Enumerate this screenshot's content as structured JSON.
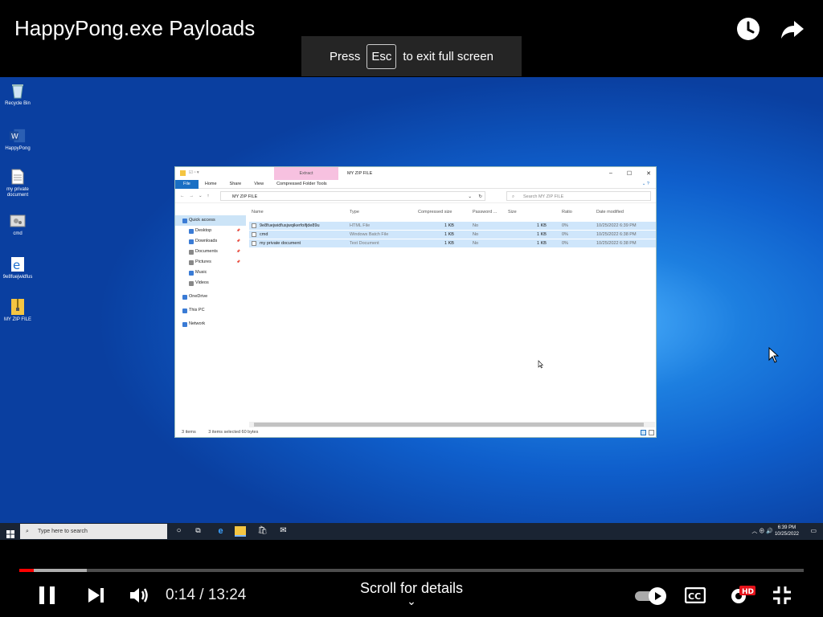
{
  "player": {
    "title": "HappyPong.exe Payloads",
    "esc_press": "Press",
    "esc_key": "Esc",
    "esc_suffix": "to exit full screen",
    "time": "0:14 / 13:24",
    "scroll_details": "Scroll for details",
    "progress_played": 0.018,
    "progress_buffered": 0.086,
    "hd_badge": "HD",
    "cc_label": "CC",
    "accent": "#ff0000"
  },
  "desktop": {
    "icons": [
      {
        "label": "Recycle Bin",
        "icon": "recycle-bin-icon"
      },
      {
        "label": "HappyPong",
        "icon": "word-doc-icon"
      },
      {
        "label": "my private document",
        "icon": "text-file-icon"
      },
      {
        "label": "cmd",
        "icon": "batch-file-icon"
      },
      {
        "label": "9e8fuejwidfus",
        "icon": "edge-html-icon"
      },
      {
        "label": "MY ZIP FILE",
        "icon": "zip-folder-icon"
      }
    ]
  },
  "explorer": {
    "extract_tab": "Extract",
    "title": "MY ZIP FILE",
    "ribbon": [
      "File",
      "Home",
      "Share",
      "View",
      "Compressed Folder Tools"
    ],
    "address": "MY ZIP FILE",
    "search_placeholder": "Search MY ZIP FILE",
    "nav": [
      {
        "label": "Quick access",
        "selected": true,
        "pinned": false
      },
      {
        "label": "Desktop",
        "selected": false,
        "pinned": true
      },
      {
        "label": "Downloads",
        "selected": false,
        "pinned": true
      },
      {
        "label": "Documents",
        "selected": false,
        "pinned": true
      },
      {
        "label": "Pictures",
        "selected": false,
        "pinned": true
      },
      {
        "label": "Music",
        "selected": false,
        "pinned": false
      },
      {
        "label": "Videos",
        "selected": false,
        "pinned": false
      },
      {
        "label": "OneDrive",
        "selected": false,
        "pinned": false
      },
      {
        "label": "This PC",
        "selected": false,
        "pinned": false
      },
      {
        "label": "Network",
        "selected": false,
        "pinned": false
      }
    ],
    "columns": [
      "Name",
      "Type",
      "Compressed size",
      "Password ...",
      "Size",
      "Ratio",
      "Date modified"
    ],
    "files": [
      {
        "name": "9e8fuejwidfusjwqikerfoifjde89u",
        "type": "HTML File",
        "compressed": "1 KB",
        "password": "No",
        "size": "1 KB",
        "ratio": "0%",
        "date": "10/25/2022 6:39 PM"
      },
      {
        "name": "cmd",
        "type": "Windows Batch File",
        "compressed": "1 KB",
        "password": "No",
        "size": "1 KB",
        "ratio": "0%",
        "date": "10/25/2022 6:38 PM"
      },
      {
        "name": "my private document",
        "type": "Text Document",
        "compressed": "1 KB",
        "password": "No",
        "size": "1 KB",
        "ratio": "0%",
        "date": "10/25/2022 6:38 PM"
      }
    ],
    "status": {
      "items": "3 items",
      "selected": "3 items selected  60 bytes"
    }
  },
  "taskbar": {
    "search_placeholder": "Type here to search",
    "time": "6:39 PM",
    "date": "10/25/2022"
  }
}
